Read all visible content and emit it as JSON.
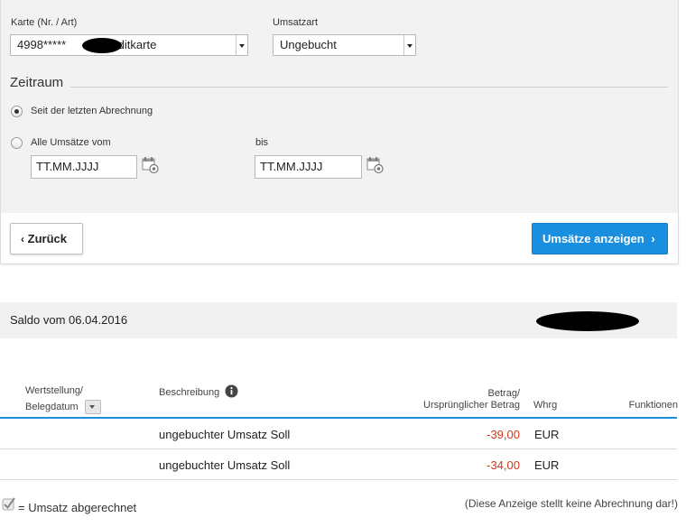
{
  "filter": {
    "card_label": "Karte (Nr. / Art)",
    "card_value_prefix": "4998*****",
    "card_value_suffix": "/ Kreditkarte",
    "type_label": "Umsatzart",
    "type_value": "Ungebucht",
    "period_title": "Zeitraum",
    "radio_since_last": "Seit der letzten Abrechnung",
    "radio_all_from": "Alle Umsätze vom",
    "to_label": "bis",
    "from_placeholder": "TT.MM.JJJJ",
    "to_placeholder": "TT.MM.JJJJ",
    "back_button": "Zurück",
    "show_button": "Umsätze anzeigen"
  },
  "saldo": {
    "label": "Saldo vom 06.04.2016"
  },
  "table": {
    "headers": {
      "date_line1": "Wertstellung/",
      "date_line2": "Belegdatum",
      "description": "Beschreibung",
      "amount_line1": "Betrag/",
      "amount_line2": "Ursprünglicher Betrag",
      "currency": "Whrg",
      "functions": "Funktionen"
    },
    "rows": [
      {
        "date": "",
        "description": "ungebuchter Umsatz Soll",
        "amount": "-39,00",
        "currency": "EUR"
      },
      {
        "date": "",
        "description": "ungebuchter Umsatz Soll",
        "amount": "-34,00",
        "currency": "EUR"
      }
    ]
  },
  "footer": {
    "legend": "= Umsatz abgerechnet",
    "disclaimer": "(Diese Anzeige stellt keine Abrechnung dar!)"
  },
  "colors": {
    "primary": "#1a8fe0",
    "negative": "#d0391c",
    "table_header_rule": "#1a8fe0"
  }
}
